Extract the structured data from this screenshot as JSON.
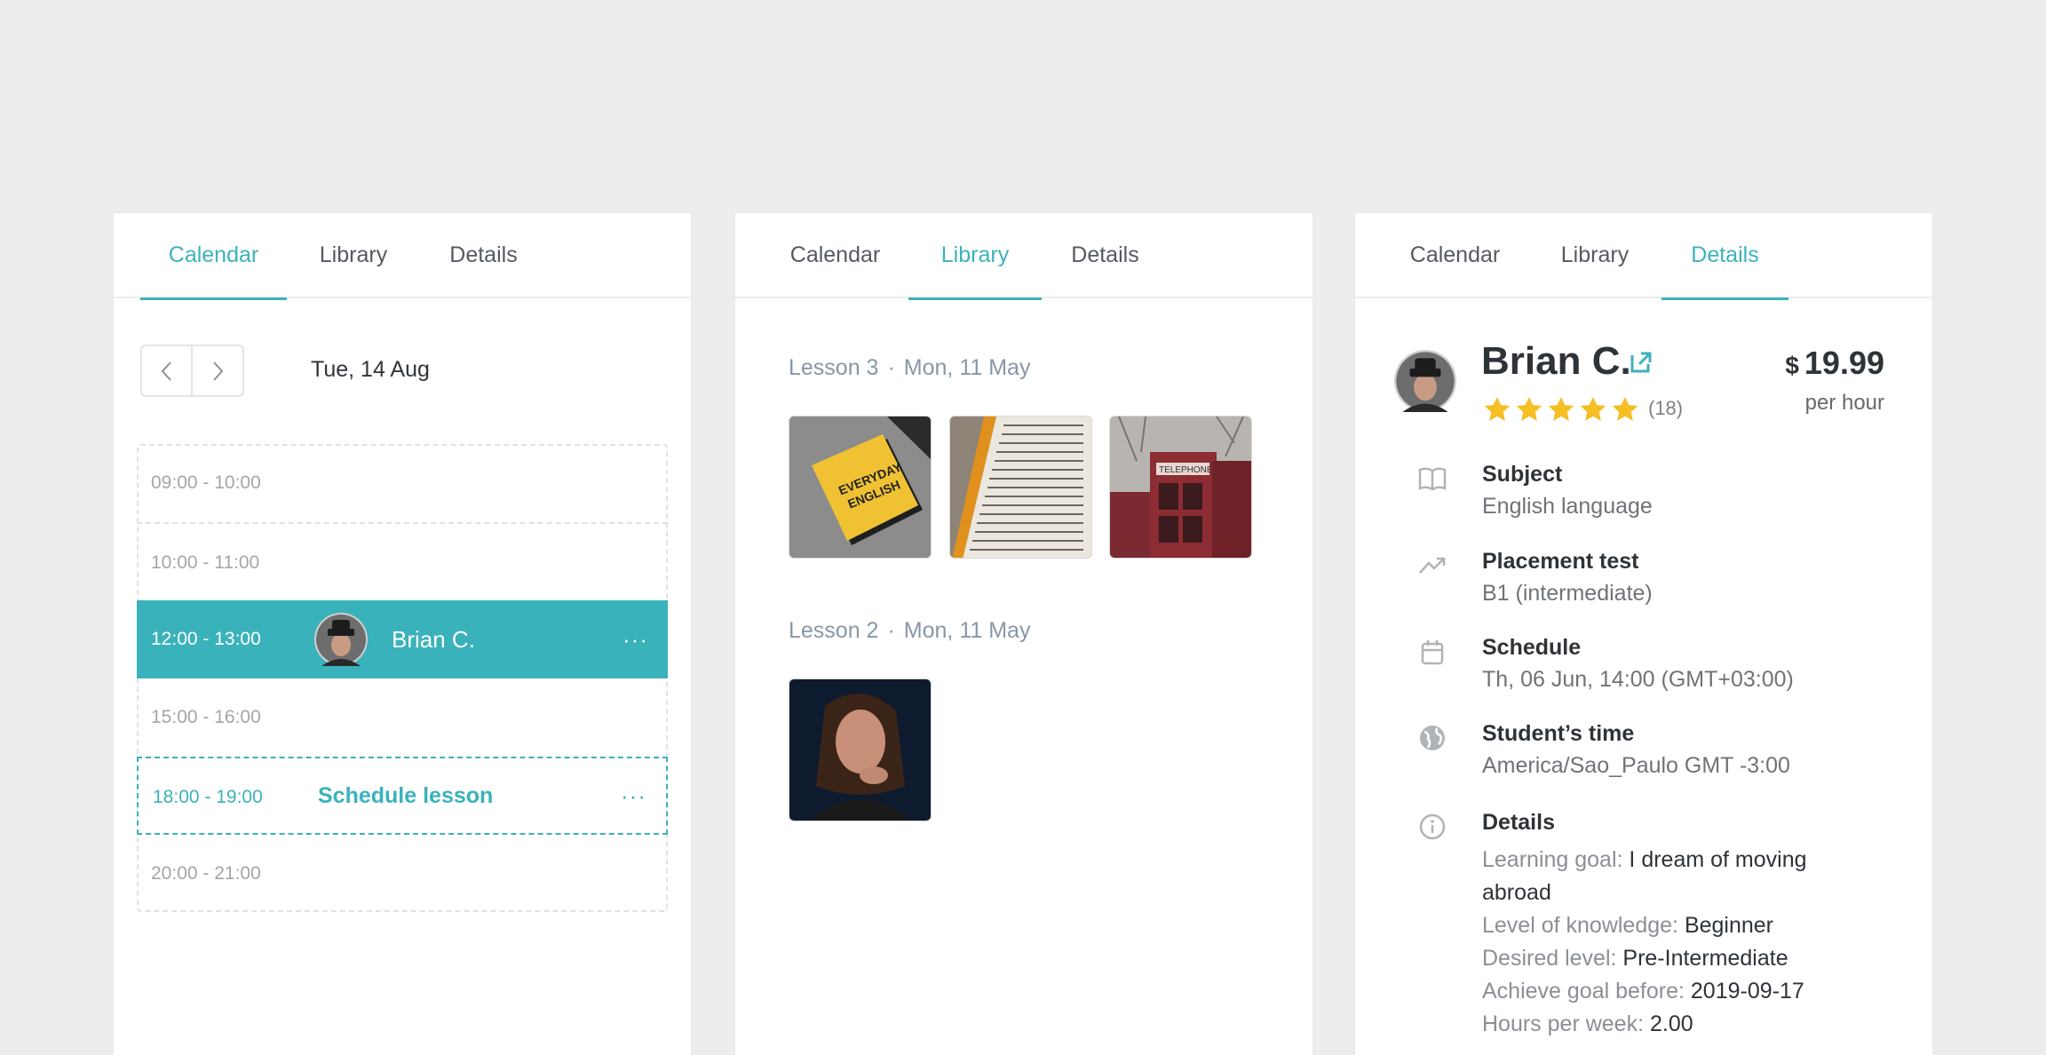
{
  "tabs": [
    "Calendar",
    "Library",
    "Details"
  ],
  "calendar": {
    "date": "Tue, 14 Aug",
    "slots": [
      {
        "time": "09:00 - 10:00"
      },
      {
        "time": "10:00 - 11:00"
      },
      {
        "time": "12:00 - 13:00",
        "student": "Brian C.",
        "more": "···"
      },
      {
        "time": "15:00 - 16:00"
      },
      {
        "time": "18:00 - 19:00",
        "action": "Schedule lesson",
        "more": "···"
      },
      {
        "time": "20:00 - 21:00"
      }
    ]
  },
  "library": {
    "lessons": [
      {
        "name": "Lesson 3",
        "sep": "·",
        "date": "Mon, 11 May",
        "thumbs": [
          "book-everyday-english",
          "dictionary-pages",
          "red-telephone-booths"
        ]
      },
      {
        "name": "Lesson 2",
        "sep": "·",
        "date": "Mon, 11 May",
        "thumbs": [
          "woman-portrait"
        ]
      }
    ]
  },
  "details": {
    "name": "Brian C.",
    "rating_count": "(18)",
    "stars": 5,
    "currency": "$",
    "price": "19.99",
    "per": "per hour",
    "items": [
      {
        "icon": "book-icon",
        "title": "Subject",
        "value": "English language"
      },
      {
        "icon": "trending-up-icon",
        "title": "Placement test",
        "value": "B1 (intermediate)"
      },
      {
        "icon": "calendar-icon",
        "title": "Schedule",
        "value": "Th, 06 Jun, 14:00 (GMT+03:00)"
      },
      {
        "icon": "globe-icon",
        "title": "Student’s time",
        "value": "America/Sao_Paulo GMT -3:00"
      },
      {
        "icon": "info-icon",
        "title": "Details"
      }
    ],
    "more": [
      {
        "label": "Learning goal:",
        "value": "I dream of moving abroad"
      },
      {
        "label": "Level of knowledge:",
        "value": "Beginner"
      },
      {
        "label": "Desired level:",
        "value": "Pre-Intermediate"
      },
      {
        "label": "Achieve goal before:",
        "value": "2019-09-17"
      },
      {
        "label": "Hours per week:",
        "value": "2.00"
      }
    ]
  },
  "colors": {
    "accent": "#3cb2bc",
    "star": "#f6be25",
    "background": "#ededed"
  }
}
